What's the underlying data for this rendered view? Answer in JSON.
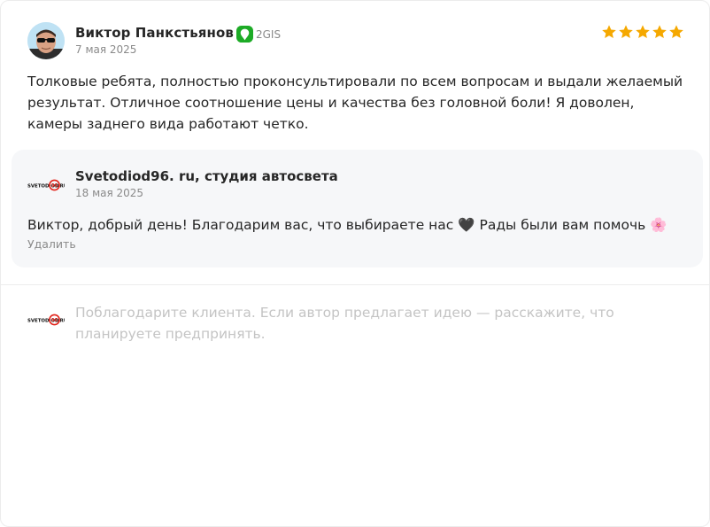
{
  "review": {
    "author_name": "Виктор Панкстьянов",
    "source_label": "2GIS",
    "date": "7 мая 2025",
    "rating": 5,
    "text": "Толковые ребята, полностью проконсультировали по всем вопросам и выдали желаемый результат. Отличное соотношение цены и качества без головной боли! Я доволен, камеры заднего вида работают четко."
  },
  "reply": {
    "business_name": "Svetodiod96. ru, студия автосвета",
    "date": "18 мая 2025",
    "text": "Виктор, добрый день! Благодарим вас, что выбираете нас 🖤 Рады были вам помочь 🌸",
    "delete_label": "Удалить"
  },
  "composer": {
    "placeholder": "Поблагодарите клиента. Если автор предлагает идею — расскажите, что планируете предпринять."
  },
  "logo_text": {
    "part1": "SVETODIOD",
    "badge": "96",
    "part2": "RU"
  },
  "colors": {
    "star": "#f5a800",
    "source_green": "#1dab26",
    "logo_red": "#e2231a",
    "reply_bg": "#f6f7f9",
    "muted_text": "#8a8a8a",
    "placeholder": "#c4c4c4"
  }
}
